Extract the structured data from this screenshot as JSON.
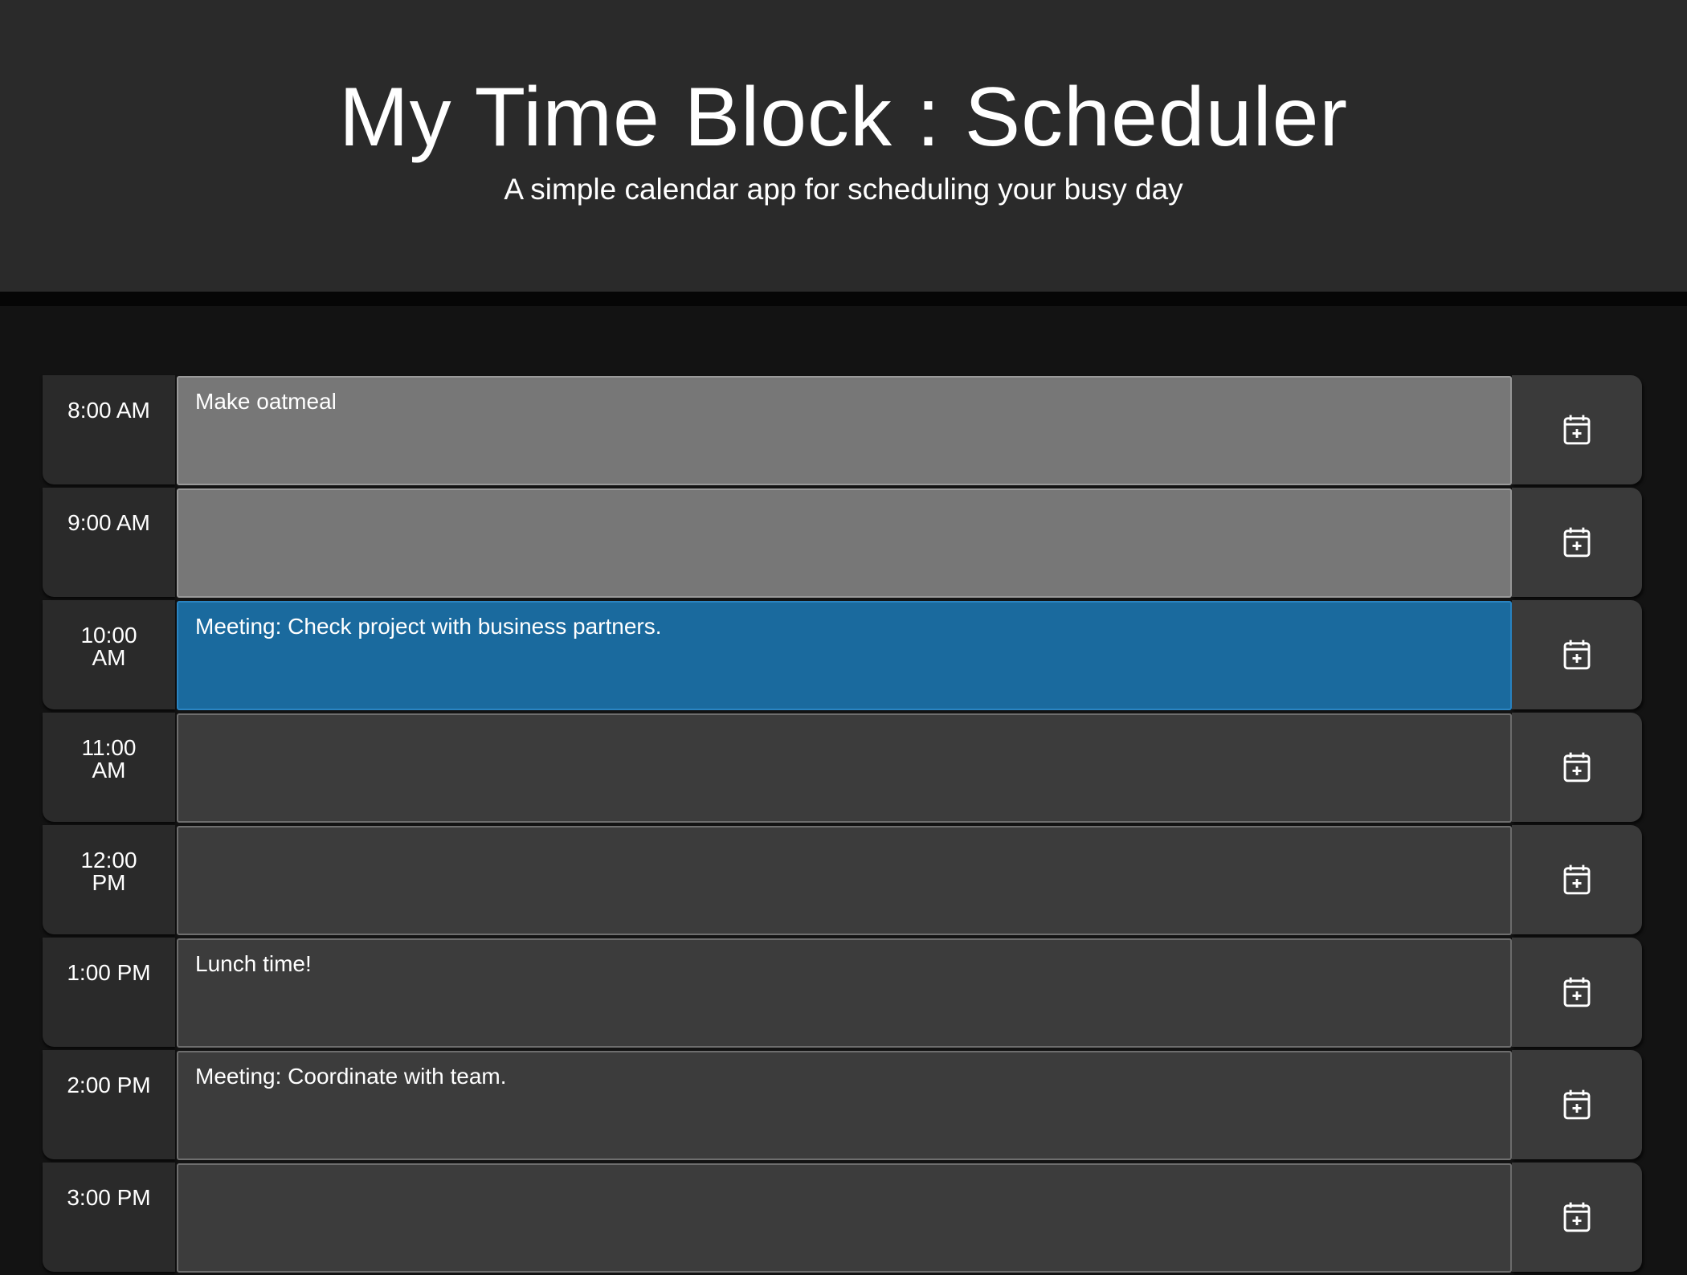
{
  "header": {
    "title": "My Time Block : Scheduler",
    "subtitle": "A simple calendar app for scheduling your busy day"
  },
  "colors": {
    "past": "#777777",
    "present": "#1a6a9e",
    "future": "#3c3c3c"
  },
  "timeblocks": [
    {
      "hour": "8:00 AM",
      "text": "Make oatmeal",
      "state": "past",
      "save_icon": "calendar-plus-icon"
    },
    {
      "hour": "9:00 AM",
      "text": "",
      "state": "past",
      "save_icon": "calendar-plus-icon"
    },
    {
      "hour": "10:00 AM",
      "text": "Meeting: Check project with business partners.",
      "state": "present",
      "save_icon": "calendar-plus-icon"
    },
    {
      "hour": "11:00 AM",
      "text": "",
      "state": "future",
      "save_icon": "calendar-plus-icon"
    },
    {
      "hour": "12:00 PM",
      "text": "",
      "state": "future",
      "save_icon": "calendar-plus-icon"
    },
    {
      "hour": "1:00 PM",
      "text": "Lunch time!",
      "state": "future",
      "save_icon": "calendar-plus-icon"
    },
    {
      "hour": "2:00 PM",
      "text": "Meeting: Coordinate with team.",
      "state": "future",
      "save_icon": "calendar-plus-icon"
    },
    {
      "hour": "3:00 PM",
      "text": "",
      "state": "future",
      "save_icon": "calendar-plus-icon"
    }
  ]
}
